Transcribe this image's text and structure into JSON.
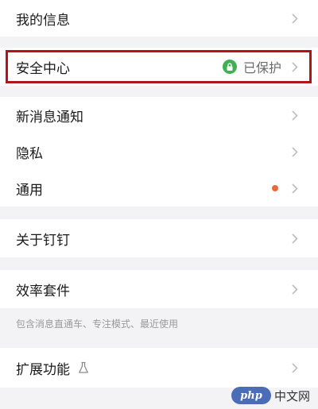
{
  "settings": {
    "my_info": "我的信息",
    "security_center": "安全中心",
    "security_status": "已保护",
    "new_message_notify": "新消息通知",
    "privacy": "隐私",
    "general": "通用",
    "about": "关于钉钉",
    "efficiency_suite": "效率套件",
    "efficiency_desc": "包含消息直通车、专注模式、最近使用",
    "extensions": "扩展功能"
  },
  "watermark": {
    "logo": "php",
    "text": "中文网"
  },
  "colors": {
    "highlight_border": "#b3141b",
    "shield_green": "#3fb054",
    "badge_dot": "#e86a3c"
  },
  "icons": [
    "chevron-right-icon",
    "lock-shield-icon",
    "notification-dot",
    "flask-icon"
  ]
}
